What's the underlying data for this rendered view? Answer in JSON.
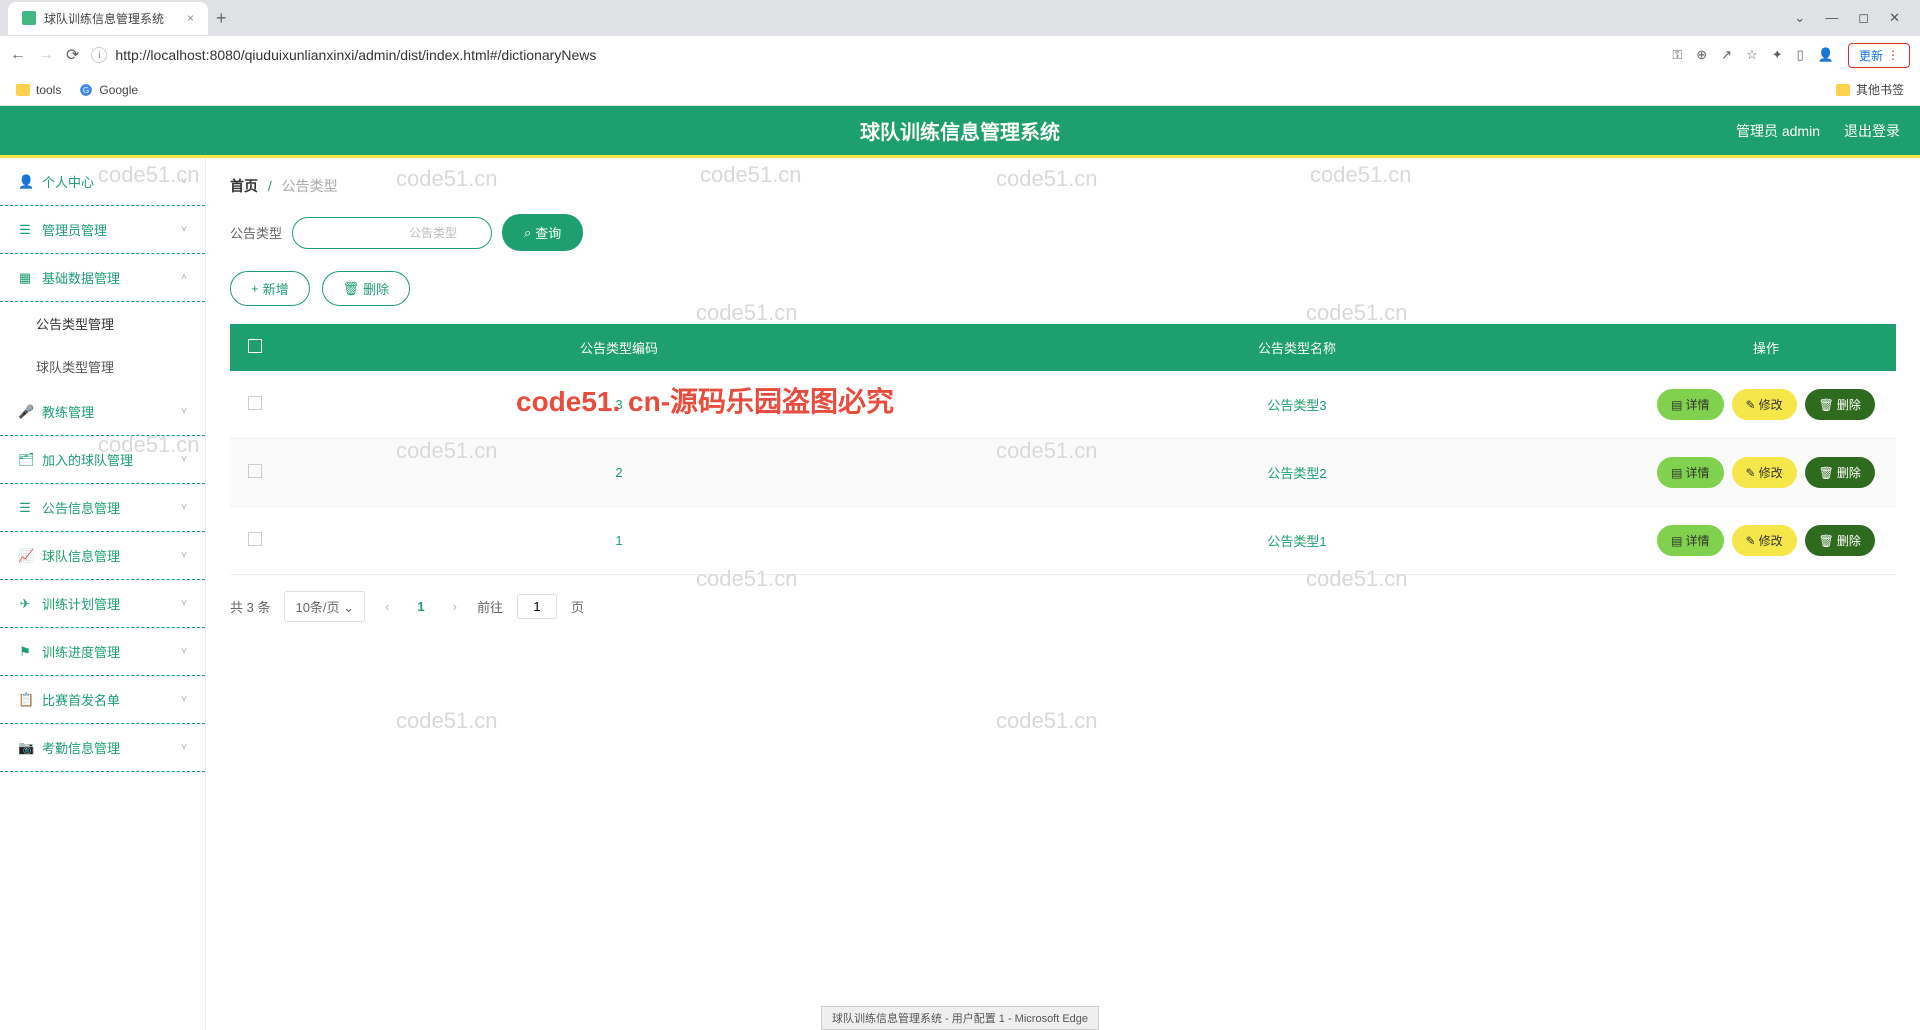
{
  "browser": {
    "tab_title": "球队训练信息管理系统",
    "url": "http://localhost:8080/qiuduixunlianxinxi/admin/dist/index.html#/dictionaryNews",
    "update_btn": "更新",
    "bookmarks": {
      "tools": "tools",
      "google": "Google",
      "other": "其他书签"
    }
  },
  "header": {
    "title": "球队训练信息管理系统",
    "user": "管理员 admin",
    "logout": "退出登录"
  },
  "sidebar": {
    "items": [
      {
        "icon": "👤",
        "label": "个人中心"
      },
      {
        "icon": "☰",
        "label": "管理员管理"
      },
      {
        "icon": "▦",
        "label": "基础数据管理",
        "expanded": true,
        "children": [
          {
            "label": "公告类型管理",
            "active": true
          },
          {
            "label": "球队类型管理"
          }
        ]
      },
      {
        "icon": "🎤",
        "label": "教练管理"
      },
      {
        "icon": "🗂",
        "label": "加入的球队管理"
      },
      {
        "icon": "☰",
        "label": "公告信息管理"
      },
      {
        "icon": "📈",
        "label": "球队信息管理"
      },
      {
        "icon": "✈",
        "label": "训练计划管理"
      },
      {
        "icon": "⚑",
        "label": "训练进度管理"
      },
      {
        "icon": "📋",
        "label": "比赛首发名单"
      },
      {
        "icon": "📷",
        "label": "考勤信息管理"
      }
    ]
  },
  "breadcrumb": {
    "home": "首页",
    "current": "公告类型"
  },
  "search": {
    "label": "公告类型",
    "placeholder": "公告类型",
    "btn": "查询"
  },
  "actions": {
    "add": "新增",
    "del": "删除"
  },
  "table": {
    "cols": [
      "",
      "公告类型编码",
      "公告类型名称",
      "操作"
    ],
    "rows": [
      {
        "code": "3",
        "name": "公告类型3"
      },
      {
        "code": "2",
        "name": "公告类型2"
      },
      {
        "code": "1",
        "name": "公告类型1"
      }
    ],
    "btns": {
      "detail": "详情",
      "edit": "修改",
      "del": "删除"
    }
  },
  "pager": {
    "total": "共 3 条",
    "size": "10条/页",
    "page": "1",
    "goto": "前往",
    "goto_val": "1",
    "unit": "页"
  },
  "watermark": "code51.cn",
  "watermark_red": "code51. cn-源码乐园盗图必究",
  "taskbar": "球队训练信息管理系统 - 用户配置 1 - Microsoft Edge"
}
